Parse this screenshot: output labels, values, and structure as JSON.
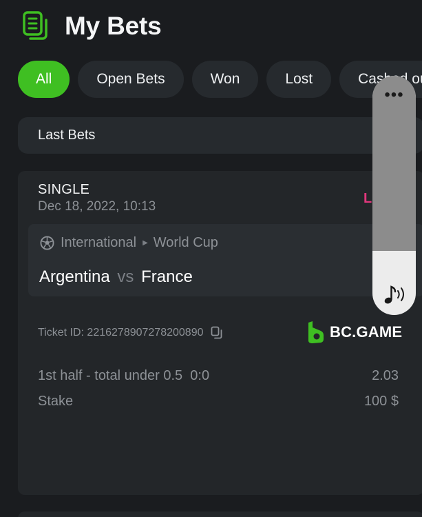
{
  "header": {
    "title": "My Bets",
    "icon": "bets-list-icon",
    "icon_color": "#3fbf22"
  },
  "tabs": [
    {
      "label": "All",
      "active": true
    },
    {
      "label": "Open Bets",
      "active": false
    },
    {
      "label": "Won",
      "active": false
    },
    {
      "label": "Lost",
      "active": false
    },
    {
      "label": "Cashed out",
      "active": false
    }
  ],
  "last_bets_label": "Last Bets",
  "bet": {
    "type": "SINGLE",
    "date": "Dec 18, 2022, 10:13",
    "status": "Lost",
    "status_color": "#e0377c",
    "league": "International",
    "tournament": "World Cup",
    "home": "Argentina",
    "vs": "vs",
    "away": "France",
    "ticket_label": "Ticket ID:",
    "ticket_id": "2216278907278200890",
    "brand": "BC.GAME",
    "market": "1st half - total under 0.5",
    "score": "0:0",
    "odds": "2.03",
    "stake_label": "Stake",
    "stake_value": "100 $"
  },
  "colors": {
    "accent": "#3fbf22",
    "background": "#1a1c1f",
    "card": "#232629",
    "lost": "#e0377c"
  }
}
